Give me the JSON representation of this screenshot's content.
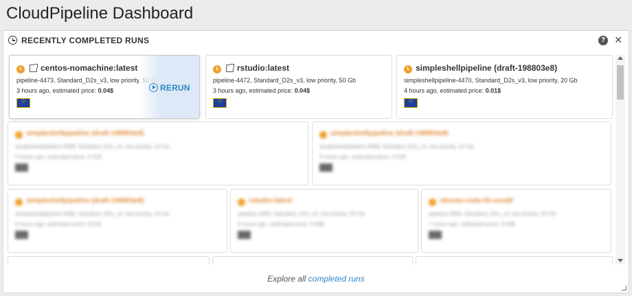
{
  "app": {
    "title": "CloudPipeline Dashboard"
  },
  "panel": {
    "title": "RECENTLY COMPLETED RUNS",
    "help_label": "?",
    "close_label": "✕",
    "icon": "clock-icon"
  },
  "runs": [
    {
      "name": "centos-nomachine:latest",
      "details": "pipeline-4473, Standard_D2s_v3, low priority, 50 Gb",
      "time_prefix": "3 hours ago, estimated price: ",
      "price": "0.04$",
      "rerun_label": "RERUN",
      "region_icon": "eu-flag-icon"
    },
    {
      "name": "rstudio:latest",
      "details": "pipeline-4472, Standard_D2s_v3, low priority, 50 Gb",
      "time_prefix": "3 hours ago, estimated price: ",
      "price": "0.04$",
      "region_icon": "eu-flag-icon"
    },
    {
      "name": "simpleshellpipeline (draft-198803e8)",
      "details": "simpleshellpipeline-4470, Standard_D2s_v3, low priority, 20 Gb",
      "time_prefix": "4 hours ago, estimated price: ",
      "price": "0.01$",
      "region_icon": "eu-flag-icon"
    }
  ],
  "blurred_runs": [
    {
      "name": "simpleshellpipeline (draft-198803e8)",
      "details": "simpleshellpipeline-4469, Standard_D2s_v3, low priority, 20 Gb",
      "time": "5 hours ago, estimated price: 0.01$"
    },
    {
      "name": "simpleshellpipeline (draft-198803e8)",
      "details": "simpleshellpipeline-4468, Standard_D2s_v3, low priority, 20 Gb",
      "time": "5 hours ago, estimated price: 0.01$"
    },
    {
      "name": "simpleshellpipeline (draft-198803e8)",
      "details": "simpleshellpipeline-4466, Standard_D2s_v3, low priority, 20 Gb",
      "time": "6 hours ago, estimated price: 0.01$"
    },
    {
      "name": "rstudio:latest",
      "details": "pipeline-4465, Standard_D2s_v3, low priority, 50 Gb",
      "time": "6 hours ago, estimated price: 0.04$"
    },
    {
      "name": "ubuntu-code-fit-condif",
      "details": "pipeline-4464, Standard_D2s_v3, low priority, 50 Gb",
      "time": "7 hours ago, estimated price: 0.04$"
    }
  ],
  "footer": {
    "prefix": "Explore all ",
    "link_label": "completed runs"
  },
  "colors": {
    "accent": "#2f86c8",
    "status_orange": "#f0a030",
    "rerun_bg": "#dde9f6"
  }
}
